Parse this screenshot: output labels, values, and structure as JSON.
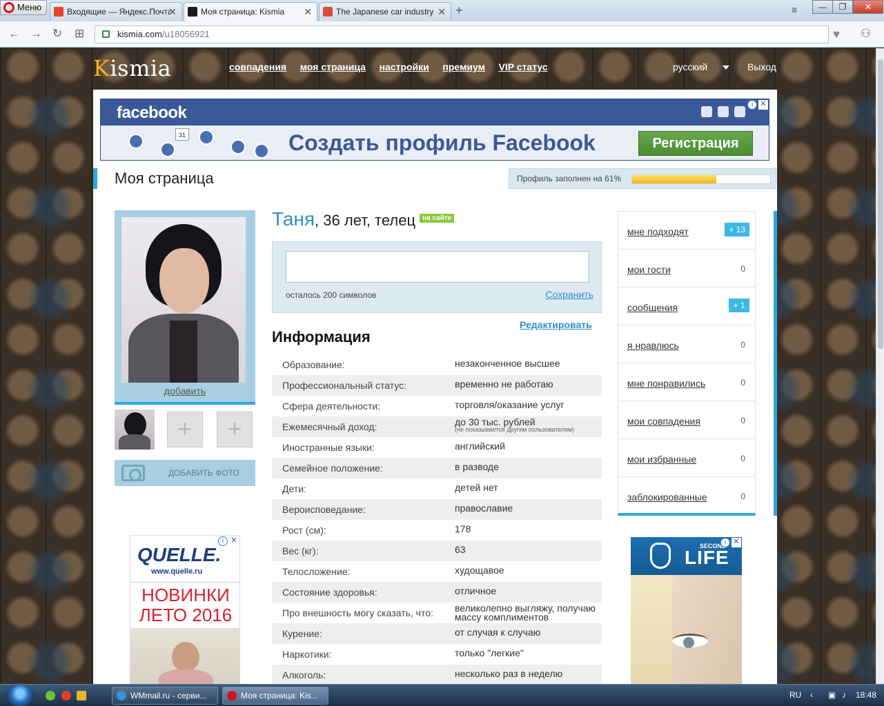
{
  "browser": {
    "menu_label": "Меню",
    "tabs": [
      {
        "title": "Входящие — Яндекс.Почта",
        "favicon_color": "#e8452c"
      },
      {
        "title": "Моя страница: Kismia",
        "favicon_color": "#1a1a1a"
      },
      {
        "title": "The Japanese car industry",
        "favicon_color": "#dd4b39"
      }
    ],
    "new_tab": "+",
    "url_domain": "kismia.com",
    "url_path": "/u18056921"
  },
  "site": {
    "logo_k": "K",
    "logo_rest": "ismia",
    "nav": [
      "совпадения",
      "моя страница",
      "настройки",
      "премиум",
      "VIP статус"
    ],
    "language": "русский",
    "logout": "Выход"
  },
  "fb_ad": {
    "logo": "facebook",
    "headline": "Создать профиль Facebook",
    "button": "Регистрация",
    "calendar_num": "31"
  },
  "page": {
    "title": "Моя страница",
    "profile_fill_label": "Профиль заполнен на 61%",
    "profile_fill_percent": 61
  },
  "profile": {
    "name": "Таня",
    "details": ", 36 лет, телец",
    "online_badge": "на сайте",
    "add_link": "добавить",
    "add_photo": "ДОБАВИТЬ ФОТО",
    "status_remaining": "осталось 200 символов",
    "save": "Сохранить",
    "edit": "Редактировать",
    "info_heading": "Информация",
    "info": [
      {
        "k": "Образование:",
        "v": "незаконченное высшее"
      },
      {
        "k": "Профессиональный статус:",
        "v": "временно не работаю"
      },
      {
        "k": "Сфера деятельности:",
        "v": "торговля/оказание услуг"
      },
      {
        "k": "Ежемесячный доход:",
        "v": "до 30 тыс. рублей",
        "note": "(не показывается другим пользователям)"
      },
      {
        "k": "Иностранные языки:",
        "v": "английский"
      },
      {
        "k": "Семейное положение:",
        "v": "в разводе"
      },
      {
        "k": "Дети:",
        "v": "детей нет"
      },
      {
        "k": "Вероисповедание:",
        "v": "православие"
      },
      {
        "k": "Рост (см):",
        "v": "178"
      },
      {
        "k": "Вес (кг):",
        "v": "63"
      },
      {
        "k": "Телосложение:",
        "v": "худощавое"
      },
      {
        "k": "Состояние здоровья:",
        "v": "отличное"
      },
      {
        "k": "Про внешность могу сказать, что:",
        "v": "великолепно выгляжу, получаю массу комплиментов"
      },
      {
        "k": "Курение:",
        "v": "от случая к случаю"
      },
      {
        "k": "Наркотики:",
        "v": "только \"легкие\""
      },
      {
        "k": "Алкоголь:",
        "v": "несколько раз в неделю"
      }
    ]
  },
  "side_menu": [
    {
      "label": "мне подходят",
      "count": "+ 13",
      "badge": true
    },
    {
      "label": "мои гости",
      "count": "0",
      "badge": false
    },
    {
      "label": "сообщения",
      "count": "+ 1",
      "badge": true
    },
    {
      "label": "я нравлюсь",
      "count": "0",
      "badge": false
    },
    {
      "label": "мне понравились",
      "count": "0",
      "badge": false
    },
    {
      "label": "мои совпадения",
      "count": "0",
      "badge": false
    },
    {
      "label": "мои избранные",
      "count": "0",
      "badge": false
    },
    {
      "label": "заблокированные",
      "count": "0",
      "badge": false
    }
  ],
  "ads": {
    "quelle_name": "QUELLE.",
    "quelle_url": "www.quelle.ru",
    "quelle_promo_1": "НОВИНКИ",
    "quelle_promo_2": "ЛЕТО 2016",
    "sl_small": "SECOND",
    "sl_big": "LIFE"
  },
  "taskbar": {
    "items": [
      "WMmail.ru - серви...",
      "Моя страница: Kis..."
    ],
    "lang": "RU",
    "time": "18:48"
  },
  "colors": {
    "accent_blue": "#2fa7dd",
    "link_blue": "#2f8fc6",
    "fb_blue": "#3b5998",
    "progress_yellow": "#f2b81c",
    "badge_blue": "#3eb7e6"
  }
}
